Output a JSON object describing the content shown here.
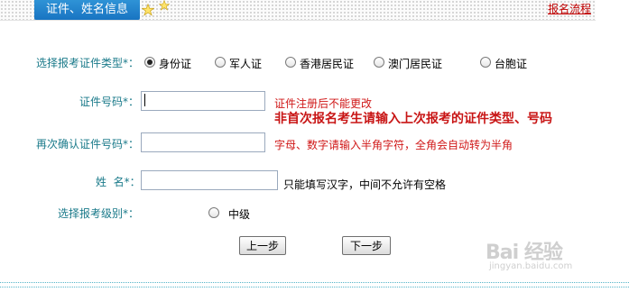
{
  "header": {
    "tab_label": "证件、姓名信息",
    "flow_link": "报名流程"
  },
  "form": {
    "id_type": {
      "label": "选择报考证件类型*：",
      "options": [
        "身份证",
        "军人证",
        "香港居民证",
        "澳门居民证",
        "台胞证"
      ],
      "selected": "身份证"
    },
    "id_number": {
      "label": "证件号码*：",
      "value": "",
      "hint": "证件注册后不能更改",
      "hint_bold": "非首次报名考生请输入上次报考的证件类型、号码"
    },
    "id_confirm": {
      "label": "再次确认证件号码*：",
      "value": "",
      "hint": "字母、数字请输入半角字符，全角会自动转为半角"
    },
    "name": {
      "label": "姓  名*：",
      "value": "",
      "hint": "只能填写汉字，中间不允许有空格"
    },
    "level": {
      "label": "选择报考级别*：",
      "options": [
        "中级"
      ],
      "selected": ""
    }
  },
  "buttons": {
    "prev": "上一步",
    "next": "下一步"
  },
  "watermark": {
    "logo": "Bai 经验",
    "sub": "jingyan.baidu.com"
  },
  "colors": {
    "tab_blue": "#1874c2",
    "label_teal": "#1a7a8a",
    "hint_red": "#d01818",
    "footer_dots": "#56b5c9"
  }
}
